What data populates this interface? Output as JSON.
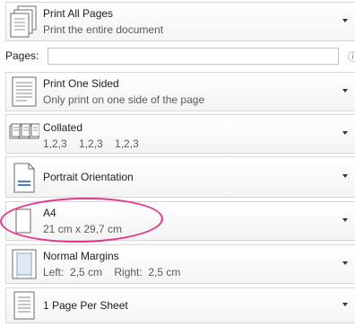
{
  "print_what": {
    "title": "Print All Pages",
    "subtitle": "Print the entire document"
  },
  "pages": {
    "label": "Pages:",
    "value": "",
    "placeholder": "",
    "info_glyph": "ⓘ"
  },
  "sides": {
    "title": "Print One Sided",
    "subtitle": "Only print on one side of the page"
  },
  "collation": {
    "title": "Collated",
    "subtitle": "1,2,3    1,2,3    1,2,3"
  },
  "orientation": {
    "title": "Portrait Orientation"
  },
  "paper_size": {
    "title": "A4",
    "subtitle": "21 cm x 29,7 cm"
  },
  "margins": {
    "title": "Normal Margins",
    "subtitle": "Left:  2,5 cm    Right:  2,5 cm"
  },
  "pages_per_sheet": {
    "title": "1 Page Per Sheet"
  },
  "colors": {
    "highlight": "#e8358c",
    "border": "#d6d6d6",
    "info": "#3a78c4"
  }
}
